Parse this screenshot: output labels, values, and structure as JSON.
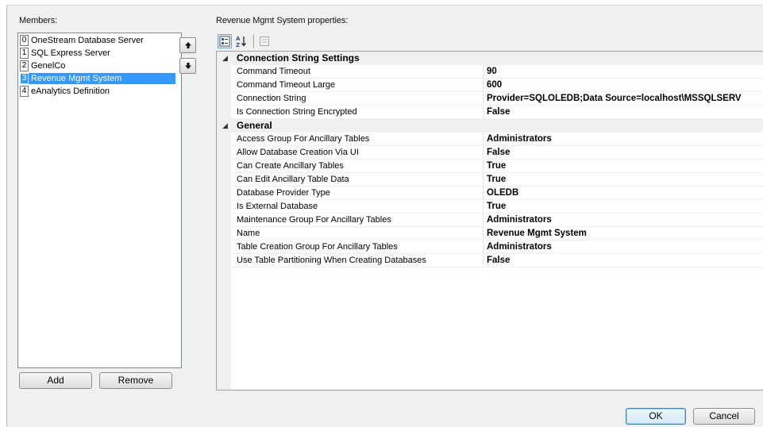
{
  "members": {
    "label": "Members:",
    "items": [
      {
        "index": "0",
        "name": "OneStream Database Server",
        "selected": false
      },
      {
        "index": "1",
        "name": "SQL Express Server",
        "selected": false
      },
      {
        "index": "2",
        "name": "GenelCo",
        "selected": false
      },
      {
        "index": "3",
        "name": "Revenue Mgmt System",
        "selected": true
      },
      {
        "index": "4",
        "name": "eAnalytics Definition",
        "selected": false
      }
    ],
    "add_label": "Add",
    "remove_label": "Remove"
  },
  "properties": {
    "label": "Revenue Mgmt System properties:",
    "categories": [
      {
        "name": "Connection String Settings",
        "rows": [
          {
            "name": "Command Timeout",
            "value": "90"
          },
          {
            "name": "Command Timeout Large",
            "value": "600"
          },
          {
            "name": "Connection String",
            "value": "Provider=SQLOLEDB;Data Source=localhost\\MSSQLSERV"
          },
          {
            "name": "Is Connection String Encrypted",
            "value": "False"
          }
        ]
      },
      {
        "name": "General",
        "rows": [
          {
            "name": "Access Group For Ancillary Tables",
            "value": "Administrators"
          },
          {
            "name": "Allow Database Creation Via UI",
            "value": "False"
          },
          {
            "name": "Can Create Ancillary Tables",
            "value": "True"
          },
          {
            "name": "Can Edit Ancillary Table Data",
            "value": "True"
          },
          {
            "name": "Database Provider Type",
            "value": "OLEDB"
          },
          {
            "name": "Is External Database",
            "value": "True"
          },
          {
            "name": "Maintenance Group For Ancillary Tables",
            "value": "Administrators"
          },
          {
            "name": "Name",
            "value": "Revenue Mgmt System"
          },
          {
            "name": "Table Creation Group For Ancillary Tables",
            "value": "Administrators"
          },
          {
            "name": "Use Table Partitioning When Creating Databases",
            "value": "False"
          }
        ]
      }
    ]
  },
  "footer": {
    "ok_label": "OK",
    "cancel_label": "Cancel"
  },
  "colors": {
    "selection": "#3399ff",
    "dialog_bg": "#f0f0f0"
  }
}
